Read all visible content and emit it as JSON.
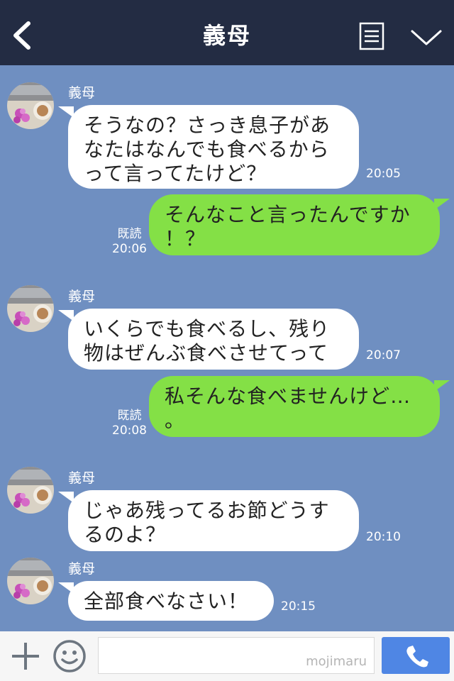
{
  "header": {
    "title": "義母",
    "back_icon": "chevron-left-icon",
    "menu_icon": "menu-lines-icon",
    "collapse_icon": "chevron-down-icon"
  },
  "messages": [
    {
      "type": "incoming",
      "sender": "義母",
      "lines": [
        "そうなの？さっき息子があ",
        "なたはなんでも食べるから",
        "って言ってたけど？"
      ],
      "time": "20:05"
    },
    {
      "type": "outgoing",
      "lines": [
        "そんなこと言ったんですか",
        "！？"
      ],
      "read": "既読",
      "time": "20:06"
    },
    {
      "type": "incoming",
      "sender": "義母",
      "lines": [
        "いくらでも食べるし、残り",
        "物はぜんぶ食べさせてって"
      ],
      "time": "20:07"
    },
    {
      "type": "outgoing",
      "lines": [
        "私そんな食べませんけど…",
        "。"
      ],
      "read": "既読",
      "time": "20:08"
    },
    {
      "type": "incoming",
      "sender": "義母",
      "lines": [
        "じゃあ残ってるお節どうす",
        "るのよ？"
      ],
      "time": "20:10"
    },
    {
      "type": "incoming",
      "sender": "義母",
      "lines": [
        "全部食べなさい！"
      ],
      "time": "20:15"
    }
  ],
  "footer": {
    "plus_icon": "plus-icon",
    "emoji_icon": "smiley-icon",
    "input_value": "",
    "watermark": "mojimaru",
    "call_icon": "phone-icon"
  },
  "colors": {
    "header_bg": "#232c43",
    "chat_bg": "#6f8fc1",
    "incoming_bubble": "#ffffff",
    "outgoing_bubble": "#84e046",
    "call_button": "#4f86e4"
  }
}
